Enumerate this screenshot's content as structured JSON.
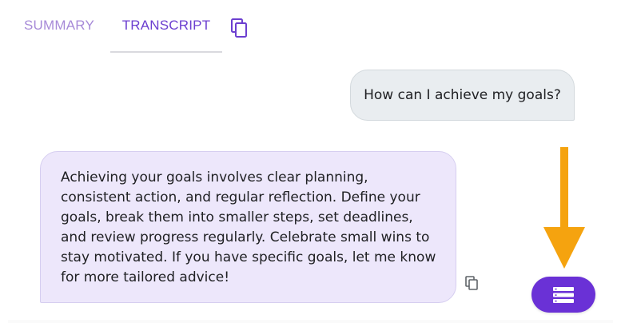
{
  "tabs": {
    "summary": "SUMMARY",
    "transcript": "TRANSCRIPT",
    "copy_icon": "copy-icon"
  },
  "messages": [
    {
      "role": "user",
      "text": "How can I achieve my goals?"
    },
    {
      "role": "assistant",
      "text": "Achieving your goals involves clear planning, consistent action, and regular reflection. Define your goals, break them into smaller steps, set deadlines, and review progress regularly. Celebrate small wins to stay motivated. If you have specific goals, let me know for more tailored advice!"
    }
  ],
  "message_copy_icon": "copy-icon",
  "fab_icon": "server-list-icon",
  "annotation_arrow": "down-arrow-icon",
  "colors": {
    "accent": "#6a31d6",
    "tab_inactive": "#a78ad8",
    "tab_active": "#6c3fd0",
    "user_bubble": "#e9edf0",
    "assistant_bubble": "#ede7fb",
    "arrow": "#f5a30f"
  }
}
